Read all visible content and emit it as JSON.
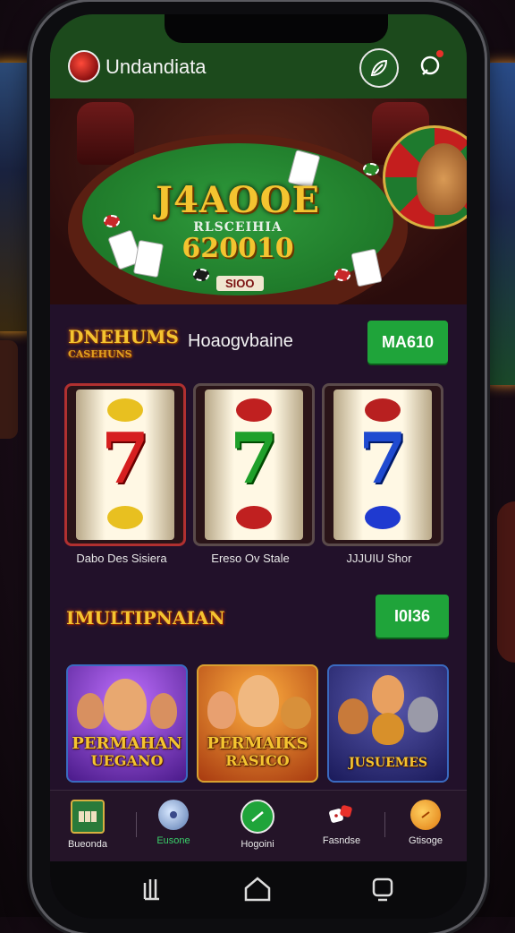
{
  "header": {
    "title": "Undandiata",
    "logo_icon": "casino-chip-icon",
    "action_icon": "leaf-icon",
    "notification_icon": "notification-icon"
  },
  "hero": {
    "main": "J4AOOE",
    "sub": "RLSCEIHIA",
    "amount": "620010",
    "badge": "SIOO"
  },
  "section1": {
    "logo_line1": "DNEHUMS",
    "logo_line2": "CASEHUNS",
    "name": "Hoaogvbaine",
    "button": "MA610",
    "reels": [
      {
        "label": "Dabo Des Sisiera",
        "seven_color": "#d61f1f",
        "fruit_color": "#e8c020"
      },
      {
        "label": "Ereso Ov Stale",
        "seven_color": "#1fa02a",
        "fruit_color": "#c02020"
      },
      {
        "label": "JJJUIU Shor",
        "seven_color": "#1f4ad0",
        "fruit_color": "#1f3ad0"
      }
    ]
  },
  "section2": {
    "logo": "IMULTIPNAIAN",
    "button": "I0I36",
    "games": [
      {
        "title": "PERMAHAN",
        "subtitle": "UEGANO"
      },
      {
        "title": "PERMAIKS",
        "subtitle": "RASICO"
      },
      {
        "title": "JUSUEMES",
        "subtitle": ""
      }
    ]
  },
  "nav": [
    {
      "label": "Bueonda",
      "icon": "slot-machine-icon"
    },
    {
      "label": "Eusone",
      "icon": "globe-icon"
    },
    {
      "label": "Hogoini",
      "icon": "circle-check-icon"
    },
    {
      "label": "Fasndse",
      "icon": "dice-icon"
    },
    {
      "label": "Gtisoge",
      "icon": "coin-icon"
    }
  ],
  "colors": {
    "header_bg": "#1c4a1c",
    "accent_green": "#1fa43a",
    "gold": "#f4c430",
    "screen_bg": "#22112a"
  }
}
